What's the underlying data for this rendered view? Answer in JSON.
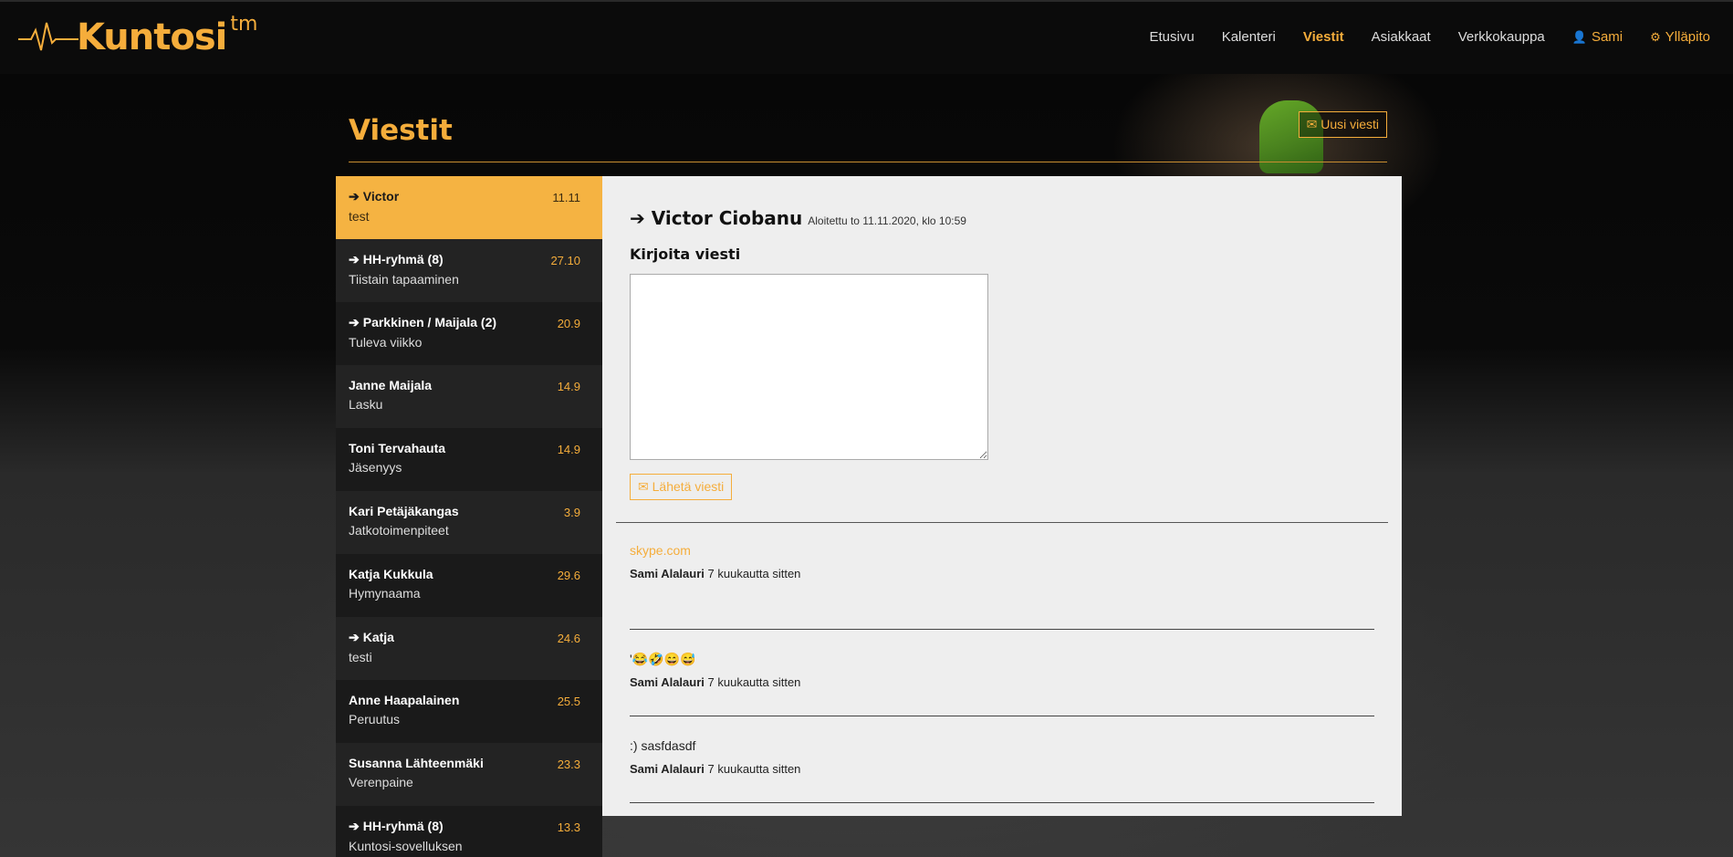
{
  "brand": {
    "name": "Kuntosi",
    "tm": "tm",
    "pulse_icon": "heartbeat-line"
  },
  "nav": {
    "items": [
      {
        "label": "Etusivu"
      },
      {
        "label": "Kalenteri"
      },
      {
        "label": "Viestit"
      },
      {
        "label": "Asiakkaat"
      },
      {
        "label": "Verkkokauppa"
      },
      {
        "label": "Sami",
        "icon": "user-icon"
      },
      {
        "label": "Ylläpito",
        "icon": "gear-icon"
      }
    ]
  },
  "page": {
    "title": "Viestit",
    "new_message_label": "Uusi viesti",
    "new_message_icon": "envelope-icon"
  },
  "conversations": [
    {
      "name": "Victor",
      "preview": "test",
      "date": "11.11",
      "outgoing": true,
      "active": true
    },
    {
      "name": "HH-ryhmä (8)",
      "preview": "Tiistain tapaaminen",
      "date": "27.10",
      "outgoing": true
    },
    {
      "name": "Parkkinen / Maijala (2)",
      "preview": "Tuleva viikko",
      "date": "20.9",
      "outgoing": true
    },
    {
      "name": "Janne Maijala",
      "preview": "Lasku",
      "date": "14.9",
      "outgoing": false
    },
    {
      "name": "Toni Tervahauta",
      "preview": "Jäsenyys",
      "date": "14.9",
      "outgoing": false
    },
    {
      "name": "Kari Petäjäkangas",
      "preview": "Jatkotoimenpiteet",
      "date": "3.9",
      "outgoing": false
    },
    {
      "name": "Katja Kukkula",
      "preview": "Hymynaama",
      "date": "29.6",
      "outgoing": false
    },
    {
      "name": "Katja",
      "preview": "testi",
      "date": "24.6",
      "outgoing": true
    },
    {
      "name": "Anne Haapalainen",
      "preview": "Peruutus",
      "date": "25.5",
      "outgoing": false
    },
    {
      "name": "Susanna Lähteenmäki",
      "preview": "Verenpaine",
      "date": "23.3",
      "outgoing": false
    },
    {
      "name": "HH-ryhmä (8)",
      "preview": "Kuntosi-sovelluksen",
      "date": "13.3",
      "outgoing": true
    }
  ],
  "conversation": {
    "title": "Victor Ciobanu",
    "started": "Aloitettu to 11.11.2020, klo 10:59",
    "write_label": "Kirjoita viesti",
    "write_value": "",
    "send_label": "Lähetä viesti",
    "send_icon": "envelope-icon",
    "messages": [
      {
        "body": "skype.com",
        "is_link": true,
        "author": "Sami Alalauri",
        "time": "7 kuukautta sitten"
      },
      {
        "body": "'😂🤣😄😅",
        "is_link": false,
        "author": "Sami Alalauri",
        "time": "7 kuukautta sitten"
      },
      {
        "body": ":) sasfdasdf",
        "is_link": false,
        "author": "Sami Alalauri",
        "time": "7 kuukautta sitten"
      }
    ]
  },
  "colors": {
    "accent": "#f5ad3b",
    "panel": "#eeeeee",
    "dark": "#0b0b0b"
  }
}
